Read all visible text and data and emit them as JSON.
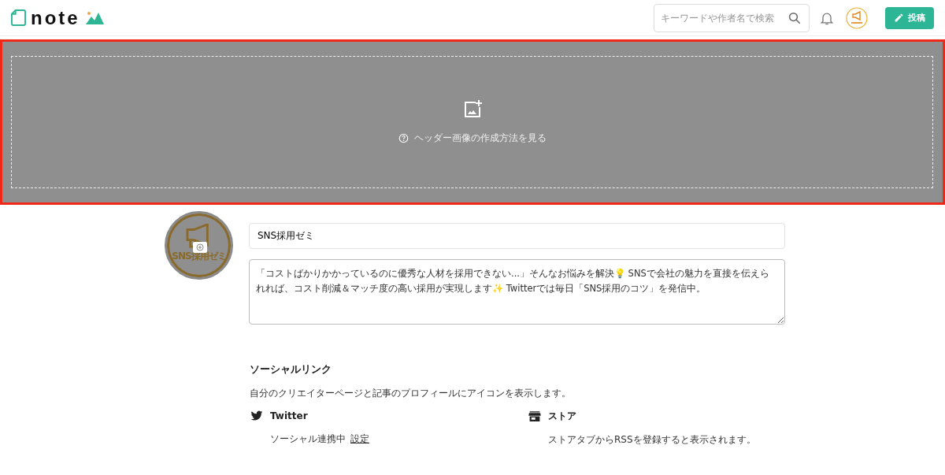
{
  "header": {
    "logo_text": "note",
    "search": {
      "placeholder": "キーワードや作者名で検索"
    },
    "post_button": "投稿"
  },
  "cover": {
    "help_link": "ヘッダー画像の作成方法を見る"
  },
  "profile": {
    "avatar_label": "SNS採用ゼミ",
    "name": "SNS採用ゼミ",
    "bio": "「コストばかりかかっているのに優秀な人材を採用できない...」そんなお悩みを解決💡 SNSで会社の魅力を直接を伝えられれば、コスト削減＆マッチ度の高い採用が実現します✨ Twitterでは毎日「SNS採用のコツ」を発信中。\n"
  },
  "social": {
    "title": "ソーシャルリンク",
    "description": "自分のクリエイターページと記事のプロフィールにアイコンを表示します。",
    "links": [
      {
        "kind": "twitter",
        "name": "Twitter",
        "status": "ソーシャル連携中",
        "action": "設定"
      },
      {
        "kind": "store",
        "name": "ストア",
        "status": "ストアタブからRSSを登録すると表示されます。"
      }
    ]
  }
}
